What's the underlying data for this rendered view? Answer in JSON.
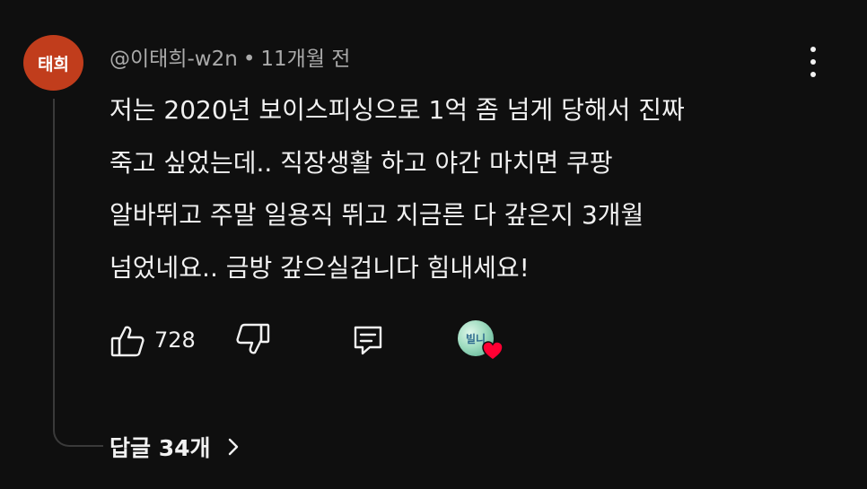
{
  "comment": {
    "avatar_text": "태희",
    "avatar_color": "#c13d1c",
    "author": "@이태희-w2n",
    "separator": "•",
    "time": "11개월 전",
    "lines": [
      "저는 2020년 보이스피싱으로 1억 좀 넘게 당해서 진짜",
      "죽고 싶었는데.. 직장생활 하고 야간 마치면 쿠팡",
      "알바뛰고 주말 일용직 뛰고 지금른 다 갚은지 3개월",
      "넘었네요.. 금방 갚으실겁니다 힘내세요!"
    ]
  },
  "actions": {
    "like_icon": "thumb-up-icon",
    "like_count": "728",
    "dislike_icon": "thumb-down-icon",
    "reply_icon": "reply-icon",
    "creator_heart_icon": "heart-icon",
    "heart_color": "#ff0033",
    "creator_avatar_text": "빌니"
  },
  "menu": {
    "icon": "more-vert-icon"
  },
  "replies": {
    "label": "답글 34개",
    "icon": "chevron-right-icon"
  }
}
